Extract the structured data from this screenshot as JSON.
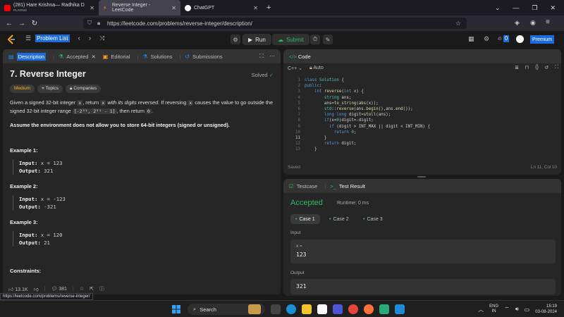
{
  "browser": {
    "tabs": [
      {
        "title": "(281) Hare Krishna— Radhika D",
        "subtitle": "PLAYING",
        "icon": "youtube-icon"
      },
      {
        "title": "Reverse Integer - LeetCode",
        "icon": "leetcode-icon"
      },
      {
        "title": "ChatGPT",
        "icon": "chatgpt-icon"
      }
    ],
    "url": "https://leetcode.com/problems/reverse-integer/description/"
  },
  "header": {
    "problem_list": "Problem List",
    "run": "Run",
    "submit": "Submit",
    "streak": "0",
    "premium": "Premium"
  },
  "left_tabs": [
    {
      "label": "Description"
    },
    {
      "label": "Accepted"
    },
    {
      "label": "Editorial"
    },
    {
      "label": "Solutions"
    },
    {
      "label": "Submissions"
    }
  ],
  "problem": {
    "title": "7. Reverse Integer",
    "status": "Solved",
    "difficulty": "Medium",
    "topics": "Topics",
    "companies": "Companies",
    "desc": {
      "p1": "Given a signed 32-bit integer ",
      "x1": "x",
      "p2": ", return ",
      "x2": "x",
      "p3": " with its digits reversed",
      "p4": ". If reversing ",
      "x3": "x",
      "p5": " causes the value to go outside the signed 32-bit integer range ",
      "range": "[-2³¹, 2³¹ - 1]",
      "p6": ", then return ",
      "zero": "0",
      "p7": "."
    },
    "assume": "Assume the environment does not allow you to store 64-bit integers (signed or unsigned).",
    "examples": [
      {
        "title": "Example 1:",
        "input_label": "Input:",
        "input": " x = 123",
        "output_label": "Output:",
        "output": " 321"
      },
      {
        "title": "Example 2:",
        "input_label": "Input:",
        "input": " x = -123",
        "output_label": "Output:",
        "output": " -321"
      },
      {
        "title": "Example 3:",
        "input_label": "Input:",
        "input": " x = 120",
        "output_label": "Output:",
        "output": " 21"
      }
    ],
    "constraints": "Constraints:",
    "likes": "13.1K",
    "comments": "381"
  },
  "code_panel": {
    "title": "Code",
    "language": "C++",
    "mode": "Auto",
    "line_numbers": [
      "1",
      "2",
      "3",
      "4",
      "5",
      "6",
      "7",
      "8",
      "9",
      "10",
      "11",
      "12",
      "13"
    ],
    "saved": "Saved",
    "cursor": "Ln 11, Col 10"
  },
  "result_panel": {
    "tab_testcase": "Testcase",
    "tab_result": "Test Result",
    "status": "Accepted",
    "runtime": "Runtime: 0 ms",
    "cases": [
      "Case 1",
      "Case 2",
      "Case 3"
    ],
    "input_label": "Input",
    "input_var": "x =",
    "input_value": "123",
    "output_label": "Output",
    "output_value": "321"
  },
  "status_url": "https://leetcode.com/problems/reverse-integer/",
  "taskbar": {
    "search": "Search",
    "lang": "ENG",
    "region": "IN",
    "time": "15:19",
    "date": "03-08-2024"
  }
}
